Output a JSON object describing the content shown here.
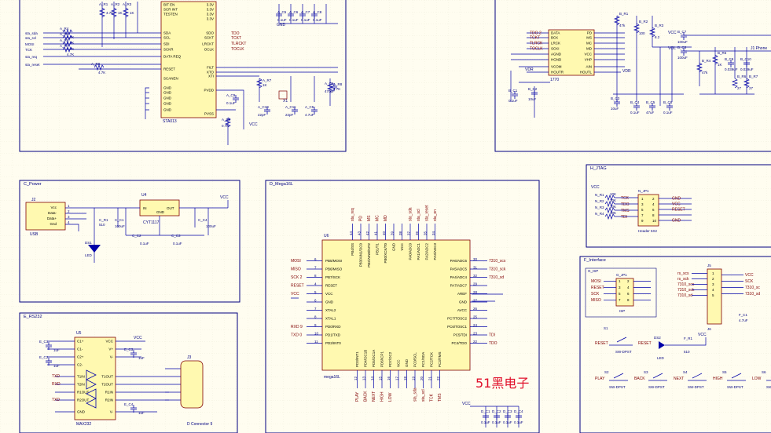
{
  "sheets": {
    "power": "C_Power",
    "mega": "D_Mega16L",
    "rs232": "E_RS232",
    "jtag": "H_JTAG",
    "interface": "F_Interface"
  },
  "top_left": {
    "u_label": "STA013",
    "pins_left": [
      "BIT EN",
      "SCR INT",
      "TESTEN",
      "SDA",
      "SCL",
      "SDI",
      "SCKR",
      "DATA REQ",
      "RESET",
      "SCANEN",
      "GND",
      "GND",
      "GND",
      "GND",
      "GND"
    ],
    "pins_right": [
      "3.3V",
      "3.3V",
      "3.3V",
      "3.3V",
      "SDO",
      "SCKT",
      "LRCKT",
      "OCLK",
      "FILT",
      "XTO",
      "XTI",
      "PVDD",
      "PVSS"
    ],
    "nets_right": [
      "TDO",
      "TCKT",
      "TLRCKT",
      "TOCLK"
    ],
    "nets_left": [
      "sta_sda",
      "sta_scl",
      "MOSI",
      "TCK",
      "sta_req",
      "sta_reset"
    ],
    "res": [
      "A_R1",
      "A_R2",
      "A_R3",
      "A_R4",
      "A_R5",
      "A_R6",
      "A_R7",
      "A_R8",
      "A_R9"
    ],
    "res_vals": [
      "4.7K",
      "1K",
      "1K",
      "4.7K",
      "4.7K",
      "4.7K",
      "4.7K",
      "4.7K",
      "1K",
      "4.7K",
      "0.7K"
    ],
    "caps": [
      "A_C5",
      "A_C6",
      "A_C7",
      "A_C8",
      "A_C9",
      "A_C10",
      "A_C11"
    ],
    "cap_vals": [
      "0.1uF",
      "0.1uF",
      "0.1uF",
      "22pF",
      "22pF",
      "4.7uF",
      "470pF",
      "10uF"
    ],
    "xtal": "X1",
    "vcc": "VCC",
    "gnd": "GND"
  },
  "top_right": {
    "u_label": "1770",
    "pins_left": [
      "DATA",
      "BCK",
      "LRCK",
      "SCKI",
      "AGND",
      "HGND",
      "VCOM",
      "HOUTR"
    ],
    "pins_right": [
      "PD",
      "MS",
      "MC",
      "MD",
      "VCC",
      "VHP",
      "AIN",
      "HOUTL"
    ],
    "nets_left": [
      "TDO 2",
      "TCKT",
      "TLRCK",
      "TOCLK"
    ],
    "vcc": "VCC",
    "vol": "VOL",
    "vdr": "VDR",
    "res": [
      "B_R1",
      "B_R2",
      "B_R3",
      "B_R4",
      "B_R5",
      "B_R6",
      "B_R7"
    ],
    "res_vals": [
      "47k",
      "100",
      "8.2",
      "47k",
      "1K",
      "27",
      "27"
    ],
    "caps": [
      "B_C1",
      "B_C2",
      "B_C3",
      "B_C4",
      "B_C5",
      "B_C6",
      "B_C7",
      "B_C8",
      "B_C9",
      "B_C10"
    ],
    "cap_vals": [
      "0.1uF",
      "10uF",
      "10uF",
      "0.1uF",
      "47uF",
      "0.1uF",
      "100uF",
      "100uF",
      "0.039uF",
      "0.039uF"
    ],
    "phone": "J1 Phone"
  },
  "power": {
    "j": "J2",
    "usb_pins": [
      "Vcc",
      "Data-",
      "Data+",
      "Gnd"
    ],
    "usb": "USB",
    "u": "U4",
    "u_pins": [
      "IN",
      "GND",
      "OUT"
    ],
    "u_label": "CYT1117",
    "r": "C_R1",
    "r_val": "510",
    "c1": "C_C1",
    "c1_val": "100uF",
    "c2": "C_C2",
    "c2_val": "0.1uF",
    "c3": "C_C3",
    "c3_val": "0.1uF",
    "c4": "C_C4",
    "c4_val": "100uF",
    "led": "LED",
    "ds": "DS1",
    "vcc": "VCC"
  },
  "mega": {
    "u": "U6",
    "u_label": "mega16L",
    "left_pins": [
      "PB5/MOSI",
      "PB6/MISO",
      "PB7/SCK",
      "RESET",
      "VCC",
      "GND",
      "XTAL2",
      "XTAL1",
      "PD0/RXD",
      "PD1/TXD",
      "PD2/INT0"
    ],
    "left_nums": [
      "6",
      "7",
      "8",
      "4",
      "5",
      "6",
      "7",
      "8",
      "9",
      "10",
      "11"
    ],
    "left_nets": [
      "MOSI",
      "MISO",
      "SCK 2",
      "RESET",
      "VCC",
      "",
      "",
      "",
      "RXD 9",
      "TXD 0",
      ""
    ],
    "right_pins": [
      "PA6/ADC6",
      "PA5/ADC5",
      "PA4/ADC4",
      "PA7/ADC7",
      "AREF",
      "GND",
      "AVCC",
      "PC7/TOSC2",
      "PC6/TOSC1",
      "PC5/TDI",
      "PC4/TDO"
    ],
    "right_nums": [
      "30",
      "31",
      "32",
      "29",
      "28",
      "27",
      "26",
      "25",
      "24",
      "23",
      "22"
    ],
    "right_nets": [
      "7310_scs",
      "7310_sck",
      "7310_sd",
      "",
      "",
      "",
      "",
      "",
      "",
      "TDI",
      "TDO"
    ],
    "top_pins": [
      "PB4/SS",
      "PB3/AIN1/OC0",
      "PB2/AIN0/INT2",
      "PB1/T1",
      "PB0/XCK/T0",
      "GND",
      "VCC",
      "PA0/ADC0",
      "PA1/ADC1",
      "PA2/ADC2",
      "PA3/ADC3"
    ],
    "top_nums": [
      "44",
      "43",
      "42",
      "41",
      "40",
      "39",
      "38",
      "37",
      "36",
      "35",
      "34"
    ],
    "top_nets": [
      "sta_req",
      "PD",
      "MS",
      "MC",
      "MD",
      "",
      "",
      "sta_sda",
      "sta_scl",
      "sta_reset",
      "sta_en"
    ],
    "bottom_pins": [
      "PD3/INT1",
      "PD4/OC1B",
      "PD5/OC1A",
      "PD6/ICP1",
      "PD7/OC2",
      "VCC",
      "GND",
      "PC0/SCL",
      "PC1/SDA",
      "PC2/TCK",
      "PC3/TMS"
    ],
    "bottom_nums": [
      "12",
      "13",
      "14",
      "15",
      "16",
      "17",
      "18",
      "19",
      "20",
      "21",
      "22"
    ],
    "bottom_nets": [
      "PLAY",
      "BACK",
      "NEXT",
      "HIGH",
      "LOW",
      "",
      "",
      "sta_sda",
      "sta_scl",
      "TCK",
      "TMS"
    ],
    "caps": [
      "D_C1",
      "D_C2",
      "D_C3",
      "D_C4"
    ],
    "cap_vals": [
      "0.1uF",
      "0.1uF",
      "0.1uF",
      "0.1uF"
    ],
    "vcc": "VCC",
    "gnd": "GND"
  },
  "rs232": {
    "u": "U5",
    "u_label": "MAX232",
    "left_pins": [
      "C1+",
      "C1-",
      "C2+",
      "C2-",
      "T1IN",
      "T2IN",
      "R1OUT",
      "R2OUT",
      "GND"
    ],
    "right_pins": [
      "VCC",
      "V+",
      "V-",
      "T1OUT",
      "T2OUT",
      "R1IN",
      "R2IN",
      "V-"
    ],
    "caps": [
      "E_C1",
      "E_C2",
      "E_C3",
      "E_C4"
    ],
    "cap_vals": [
      "1uF",
      "1uF",
      "1uF",
      "1uF"
    ],
    "nets": [
      "TXD",
      "RXD"
    ],
    "j": "J3",
    "conn": "D Connector 9",
    "vcc": "VCC"
  },
  "jtag": {
    "res": [
      "N_R1",
      "N_R2",
      "N_R3",
      "N_R4"
    ],
    "res_val": "10K",
    "nets_left": [
      "TCK",
      "TDO",
      "TMS",
      "TDI"
    ],
    "j": "N_JP1",
    "header": "Header 5X2",
    "nets_right": [
      "GND",
      "VCC",
      "RESET",
      "",
      "GND"
    ],
    "vcc": "VCC"
  },
  "interface": {
    "isp": "ISP",
    "isp_j": "G_JP1",
    "isp_label": "G_ISP",
    "isp_nets": [
      "MOSI",
      "RESET",
      "SCK",
      "MISO"
    ],
    "j5": "J5",
    "j5_label": "J6",
    "j5_nets": [
      "rs_scs",
      "rs_sck",
      "7310_scs",
      "7310_sck",
      "7310_sd"
    ],
    "j5_right": [
      "VCC",
      "SCK",
      "7310_sc",
      "7310_sd"
    ],
    "vcc": "VCC",
    "cap": "F_C1",
    "cap_val": "4.7uF",
    "s1": "S1",
    "s1_label": "SW-DPST",
    "s1_net": "RESET",
    "ds2": "DS2",
    "ds2_r": "F_R1",
    "ds2_rv": "510",
    "ds2_net": "RESET",
    "led": "LED",
    "switches": [
      {
        "ref": "S2",
        "net": "PLAY",
        "type": "SW-DPST"
      },
      {
        "ref": "S3",
        "net": "BACK",
        "type": "SW-DPST"
      },
      {
        "ref": "S4",
        "net": "NEXT",
        "type": "SW-DPST"
      },
      {
        "ref": "S5",
        "net": "HIGH",
        "type": "SW-DPST"
      },
      {
        "ref": "S6",
        "net": "LOW",
        "type": "SW-DPST"
      }
    ]
  },
  "watermark": "51黑电子",
  "colors": {
    "wire": "#0000a8",
    "frame": "#000080",
    "grid": "#cfcfcf",
    "bg": "#fffdf0",
    "part": "#fff9b0",
    "pinred": "#800000",
    "watermark": "#e0102a"
  }
}
